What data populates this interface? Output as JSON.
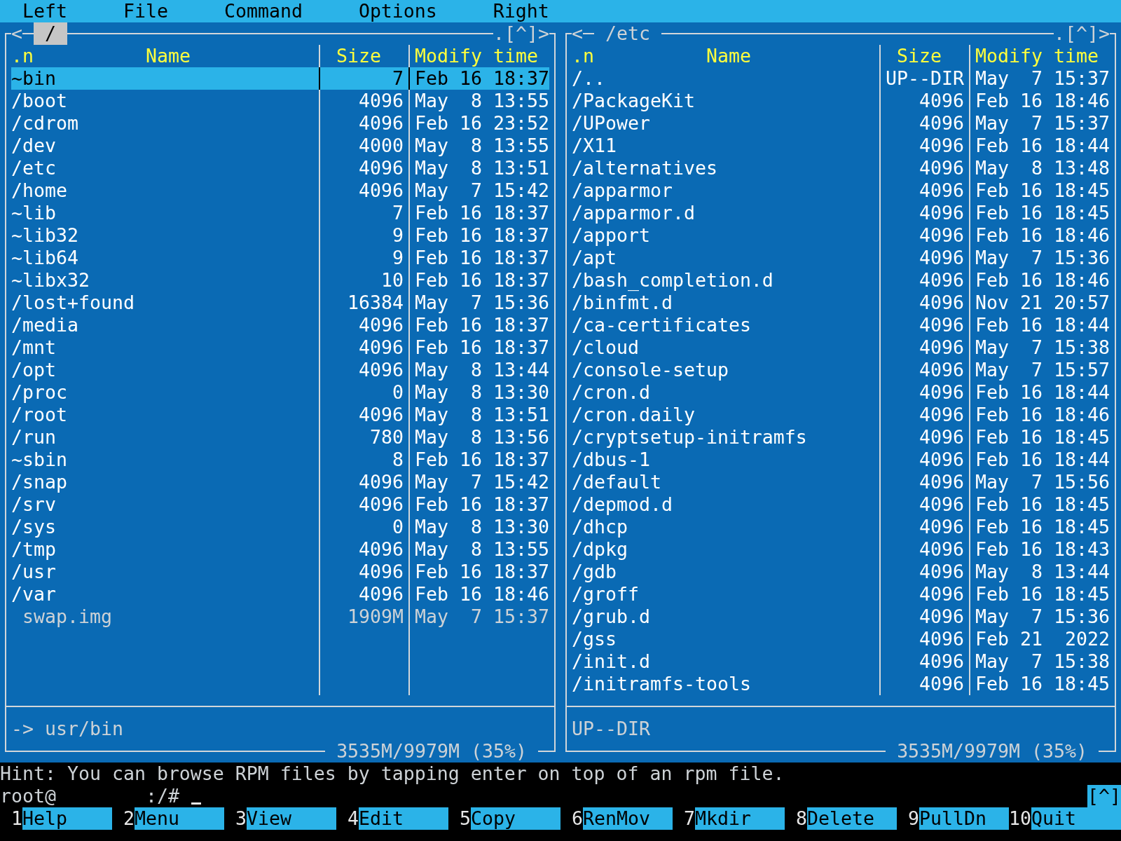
{
  "menu_bar": [
    "Left",
    "File",
    "Command",
    "Options",
    "Right"
  ],
  "panels": [
    {
      "active": true,
      "history_back": "<",
      "path": "/",
      "hidden_toggle": ".",
      "history_list": "[^]",
      "history_forward": ">",
      "columns": {
        "sort": ".n",
        "name": "Name",
        "size": "Size",
        "modified": "Modify time"
      },
      "rows": [
        {
          "name": "~bin",
          "kind": "link",
          "size": "7",
          "modified": "Feb 16 18:37",
          "selected": true
        },
        {
          "name": "/boot",
          "kind": "dir",
          "size": "4096",
          "modified": "May  8 13:55",
          "selected": false
        },
        {
          "name": "/cdrom",
          "kind": "dir",
          "size": "4096",
          "modified": "Feb 16 23:52",
          "selected": false
        },
        {
          "name": "/dev",
          "kind": "dir",
          "size": "4000",
          "modified": "May  8 13:55",
          "selected": false
        },
        {
          "name": "/etc",
          "kind": "dir",
          "size": "4096",
          "modified": "May  8 13:51",
          "selected": false
        },
        {
          "name": "/home",
          "kind": "dir",
          "size": "4096",
          "modified": "May  7 15:42",
          "selected": false
        },
        {
          "name": "~lib",
          "kind": "link",
          "size": "7",
          "modified": "Feb 16 18:37",
          "selected": false
        },
        {
          "name": "~lib32",
          "kind": "link",
          "size": "9",
          "modified": "Feb 16 18:37",
          "selected": false
        },
        {
          "name": "~lib64",
          "kind": "link",
          "size": "9",
          "modified": "Feb 16 18:37",
          "selected": false
        },
        {
          "name": "~libx32",
          "kind": "link",
          "size": "10",
          "modified": "Feb 16 18:37",
          "selected": false
        },
        {
          "name": "/lost+found",
          "kind": "dir",
          "size": "16384",
          "modified": "May  7 15:36",
          "selected": false
        },
        {
          "name": "/media",
          "kind": "dir",
          "size": "4096",
          "modified": "Feb 16 18:37",
          "selected": false
        },
        {
          "name": "/mnt",
          "kind": "dir",
          "size": "4096",
          "modified": "Feb 16 18:37",
          "selected": false
        },
        {
          "name": "/opt",
          "kind": "dir",
          "size": "4096",
          "modified": "May  8 13:44",
          "selected": false
        },
        {
          "name": "/proc",
          "kind": "dir",
          "size": "0",
          "modified": "May  8 13:30",
          "selected": false
        },
        {
          "name": "/root",
          "kind": "dir",
          "size": "4096",
          "modified": "May  8 13:51",
          "selected": false
        },
        {
          "name": "/run",
          "kind": "dir",
          "size": "780",
          "modified": "May  8 13:56",
          "selected": false
        },
        {
          "name": "~sbin",
          "kind": "link",
          "size": "8",
          "modified": "Feb 16 18:37",
          "selected": false
        },
        {
          "name": "/snap",
          "kind": "dir",
          "size": "4096",
          "modified": "May  7 15:42",
          "selected": false
        },
        {
          "name": "/srv",
          "kind": "dir",
          "size": "4096",
          "modified": "Feb 16 18:37",
          "selected": false
        },
        {
          "name": "/sys",
          "kind": "dir",
          "size": "0",
          "modified": "May  8 13:30",
          "selected": false
        },
        {
          "name": "/tmp",
          "kind": "dir",
          "size": "4096",
          "modified": "May  8 13:55",
          "selected": false
        },
        {
          "name": "/usr",
          "kind": "dir",
          "size": "4096",
          "modified": "Feb 16 18:37",
          "selected": false
        },
        {
          "name": "/var",
          "kind": "dir",
          "size": "4096",
          "modified": "Feb 16 18:46",
          "selected": false
        },
        {
          "name": "swap.img",
          "kind": "file",
          "size": "1909M",
          "modified": "May  7 15:37",
          "selected": false
        }
      ],
      "mini_status": "-> usr/bin",
      "disk_usage": "3535M/9979M (35%)"
    },
    {
      "active": false,
      "history_back": "<",
      "path": "/etc",
      "hidden_toggle": ".",
      "history_list": "[^]",
      "history_forward": ">",
      "columns": {
        "sort": ".n",
        "name": "Name",
        "size": "Size",
        "modified": "Modify time"
      },
      "rows": [
        {
          "name": "/..",
          "kind": "dir",
          "size": "UP--DIR",
          "modified": "May  7 15:37",
          "selected": false
        },
        {
          "name": "/PackageKit",
          "kind": "dir",
          "size": "4096",
          "modified": "Feb 16 18:46",
          "selected": false
        },
        {
          "name": "/UPower",
          "kind": "dir",
          "size": "4096",
          "modified": "May  7 15:37",
          "selected": false
        },
        {
          "name": "/X11",
          "kind": "dir",
          "size": "4096",
          "modified": "Feb 16 18:44",
          "selected": false
        },
        {
          "name": "/alternatives",
          "kind": "dir",
          "size": "4096",
          "modified": "May  8 13:48",
          "selected": false
        },
        {
          "name": "/apparmor",
          "kind": "dir",
          "size": "4096",
          "modified": "Feb 16 18:45",
          "selected": false
        },
        {
          "name": "/apparmor.d",
          "kind": "dir",
          "size": "4096",
          "modified": "Feb 16 18:45",
          "selected": false
        },
        {
          "name": "/apport",
          "kind": "dir",
          "size": "4096",
          "modified": "Feb 16 18:46",
          "selected": false
        },
        {
          "name": "/apt",
          "kind": "dir",
          "size": "4096",
          "modified": "May  7 15:36",
          "selected": false
        },
        {
          "name": "/bash_completion.d",
          "kind": "dir",
          "size": "4096",
          "modified": "Feb 16 18:46",
          "selected": false
        },
        {
          "name": "/binfmt.d",
          "kind": "dir",
          "size": "4096",
          "modified": "Nov 21 20:57",
          "selected": false
        },
        {
          "name": "/ca-certificates",
          "kind": "dir",
          "size": "4096",
          "modified": "Feb 16 18:44",
          "selected": false
        },
        {
          "name": "/cloud",
          "kind": "dir",
          "size": "4096",
          "modified": "May  7 15:38",
          "selected": false
        },
        {
          "name": "/console-setup",
          "kind": "dir",
          "size": "4096",
          "modified": "May  7 15:57",
          "selected": false
        },
        {
          "name": "/cron.d",
          "kind": "dir",
          "size": "4096",
          "modified": "Feb 16 18:44",
          "selected": false
        },
        {
          "name": "/cron.daily",
          "kind": "dir",
          "size": "4096",
          "modified": "Feb 16 18:46",
          "selected": false
        },
        {
          "name": "/cryptsetup-initramfs",
          "kind": "dir",
          "size": "4096",
          "modified": "Feb 16 18:45",
          "selected": false
        },
        {
          "name": "/dbus-1",
          "kind": "dir",
          "size": "4096",
          "modified": "Feb 16 18:44",
          "selected": false
        },
        {
          "name": "/default",
          "kind": "dir",
          "size": "4096",
          "modified": "May  7 15:56",
          "selected": false
        },
        {
          "name": "/depmod.d",
          "kind": "dir",
          "size": "4096",
          "modified": "Feb 16 18:45",
          "selected": false
        },
        {
          "name": "/dhcp",
          "kind": "dir",
          "size": "4096",
          "modified": "Feb 16 18:45",
          "selected": false
        },
        {
          "name": "/dpkg",
          "kind": "dir",
          "size": "4096",
          "modified": "Feb 16 18:43",
          "selected": false
        },
        {
          "name": "/gdb",
          "kind": "dir",
          "size": "4096",
          "modified": "May  8 13:44",
          "selected": false
        },
        {
          "name": "/groff",
          "kind": "dir",
          "size": "4096",
          "modified": "Feb 16 18:45",
          "selected": false
        },
        {
          "name": "/grub.d",
          "kind": "dir",
          "size": "4096",
          "modified": "May  7 15:36",
          "selected": false
        },
        {
          "name": "/gss",
          "kind": "dir",
          "size": "4096",
          "modified": "Feb 21  2022",
          "selected": false
        },
        {
          "name": "/init.d",
          "kind": "dir",
          "size": "4096",
          "modified": "May  7 15:38",
          "selected": false
        },
        {
          "name": "/initramfs-tools",
          "kind": "dir",
          "size": "4096",
          "modified": "Feb 16 18:45",
          "selected": false
        }
      ],
      "mini_status": "UP--DIR",
      "disk_usage": "3535M/9979M (35%)"
    }
  ],
  "hint": "Hint: You can browse RPM files by tapping enter on top of an rpm file.",
  "command_line": {
    "prompt": "root@        :/#",
    "history_button": "[^]"
  },
  "function_keys": [
    {
      "number": "1",
      "label": "Help"
    },
    {
      "number": "2",
      "label": "Menu"
    },
    {
      "number": "3",
      "label": "View"
    },
    {
      "number": "4",
      "label": "Edit"
    },
    {
      "number": "5",
      "label": "Copy"
    },
    {
      "number": "6",
      "label": "RenMov"
    },
    {
      "number": "7",
      "label": "Mkdir"
    },
    {
      "number": "8",
      "label": "Delete"
    },
    {
      "number": "9",
      "label": "PullDn"
    },
    {
      "number": "10",
      "label": "Quit"
    }
  ]
}
